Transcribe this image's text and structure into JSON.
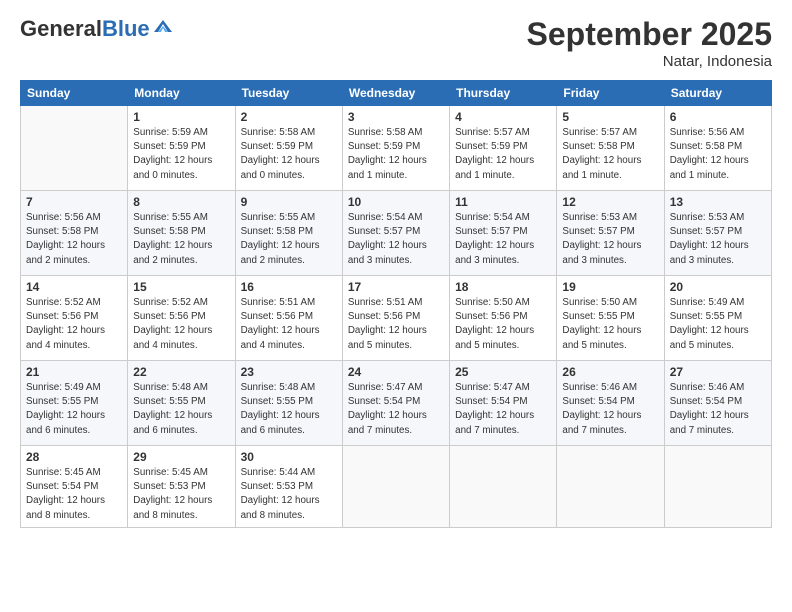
{
  "header": {
    "logo_general": "General",
    "logo_blue": "Blue",
    "month_title": "September 2025",
    "location": "Natar, Indonesia"
  },
  "days_of_week": [
    "Sunday",
    "Monday",
    "Tuesday",
    "Wednesday",
    "Thursday",
    "Friday",
    "Saturday"
  ],
  "weeks": [
    [
      {
        "day": "",
        "info": ""
      },
      {
        "day": "1",
        "info": "Sunrise: 5:59 AM\nSunset: 5:59 PM\nDaylight: 12 hours\nand 0 minutes."
      },
      {
        "day": "2",
        "info": "Sunrise: 5:58 AM\nSunset: 5:59 PM\nDaylight: 12 hours\nand 0 minutes."
      },
      {
        "day": "3",
        "info": "Sunrise: 5:58 AM\nSunset: 5:59 PM\nDaylight: 12 hours\nand 1 minute."
      },
      {
        "day": "4",
        "info": "Sunrise: 5:57 AM\nSunset: 5:59 PM\nDaylight: 12 hours\nand 1 minute."
      },
      {
        "day": "5",
        "info": "Sunrise: 5:57 AM\nSunset: 5:58 PM\nDaylight: 12 hours\nand 1 minute."
      },
      {
        "day": "6",
        "info": "Sunrise: 5:56 AM\nSunset: 5:58 PM\nDaylight: 12 hours\nand 1 minute."
      }
    ],
    [
      {
        "day": "7",
        "info": "Sunrise: 5:56 AM\nSunset: 5:58 PM\nDaylight: 12 hours\nand 2 minutes."
      },
      {
        "day": "8",
        "info": "Sunrise: 5:55 AM\nSunset: 5:58 PM\nDaylight: 12 hours\nand 2 minutes."
      },
      {
        "day": "9",
        "info": "Sunrise: 5:55 AM\nSunset: 5:58 PM\nDaylight: 12 hours\nand 2 minutes."
      },
      {
        "day": "10",
        "info": "Sunrise: 5:54 AM\nSunset: 5:57 PM\nDaylight: 12 hours\nand 3 minutes."
      },
      {
        "day": "11",
        "info": "Sunrise: 5:54 AM\nSunset: 5:57 PM\nDaylight: 12 hours\nand 3 minutes."
      },
      {
        "day": "12",
        "info": "Sunrise: 5:53 AM\nSunset: 5:57 PM\nDaylight: 12 hours\nand 3 minutes."
      },
      {
        "day": "13",
        "info": "Sunrise: 5:53 AM\nSunset: 5:57 PM\nDaylight: 12 hours\nand 3 minutes."
      }
    ],
    [
      {
        "day": "14",
        "info": "Sunrise: 5:52 AM\nSunset: 5:56 PM\nDaylight: 12 hours\nand 4 minutes."
      },
      {
        "day": "15",
        "info": "Sunrise: 5:52 AM\nSunset: 5:56 PM\nDaylight: 12 hours\nand 4 minutes."
      },
      {
        "day": "16",
        "info": "Sunrise: 5:51 AM\nSunset: 5:56 PM\nDaylight: 12 hours\nand 4 minutes."
      },
      {
        "day": "17",
        "info": "Sunrise: 5:51 AM\nSunset: 5:56 PM\nDaylight: 12 hours\nand 5 minutes."
      },
      {
        "day": "18",
        "info": "Sunrise: 5:50 AM\nSunset: 5:56 PM\nDaylight: 12 hours\nand 5 minutes."
      },
      {
        "day": "19",
        "info": "Sunrise: 5:50 AM\nSunset: 5:55 PM\nDaylight: 12 hours\nand 5 minutes."
      },
      {
        "day": "20",
        "info": "Sunrise: 5:49 AM\nSunset: 5:55 PM\nDaylight: 12 hours\nand 5 minutes."
      }
    ],
    [
      {
        "day": "21",
        "info": "Sunrise: 5:49 AM\nSunset: 5:55 PM\nDaylight: 12 hours\nand 6 minutes."
      },
      {
        "day": "22",
        "info": "Sunrise: 5:48 AM\nSunset: 5:55 PM\nDaylight: 12 hours\nand 6 minutes."
      },
      {
        "day": "23",
        "info": "Sunrise: 5:48 AM\nSunset: 5:55 PM\nDaylight: 12 hours\nand 6 minutes."
      },
      {
        "day": "24",
        "info": "Sunrise: 5:47 AM\nSunset: 5:54 PM\nDaylight: 12 hours\nand 7 minutes."
      },
      {
        "day": "25",
        "info": "Sunrise: 5:47 AM\nSunset: 5:54 PM\nDaylight: 12 hours\nand 7 minutes."
      },
      {
        "day": "26",
        "info": "Sunrise: 5:46 AM\nSunset: 5:54 PM\nDaylight: 12 hours\nand 7 minutes."
      },
      {
        "day": "27",
        "info": "Sunrise: 5:46 AM\nSunset: 5:54 PM\nDaylight: 12 hours\nand 7 minutes."
      }
    ],
    [
      {
        "day": "28",
        "info": "Sunrise: 5:45 AM\nSunset: 5:54 PM\nDaylight: 12 hours\nand 8 minutes."
      },
      {
        "day": "29",
        "info": "Sunrise: 5:45 AM\nSunset: 5:53 PM\nDaylight: 12 hours\nand 8 minutes."
      },
      {
        "day": "30",
        "info": "Sunrise: 5:44 AM\nSunset: 5:53 PM\nDaylight: 12 hours\nand 8 minutes."
      },
      {
        "day": "",
        "info": ""
      },
      {
        "day": "",
        "info": ""
      },
      {
        "day": "",
        "info": ""
      },
      {
        "day": "",
        "info": ""
      }
    ]
  ]
}
